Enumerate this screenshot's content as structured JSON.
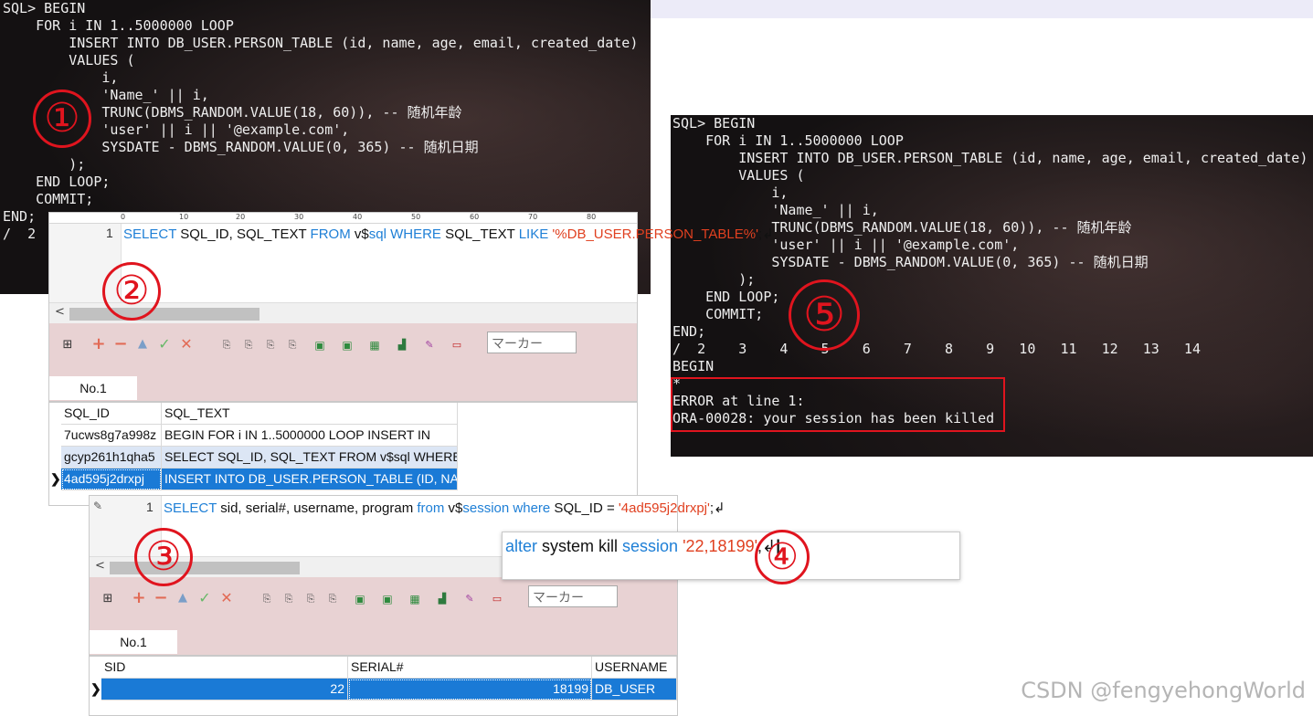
{
  "terminal1": {
    "lines": [
      "SQL> BEGIN",
      "    FOR i IN 1..5000000 LOOP",
      "        INSERT INTO DB_USER.PERSON_TABLE (id, name, age, email, created_date)",
      "        VALUES (",
      "            i,",
      "            'Name_' || i,",
      "            TRUNC(DBMS_RANDOM.VALUE(18, 60)), -- 随机年龄",
      "            'user' || i || '@example.com',",
      "            SYSDATE - DBMS_RANDOM.VALUE(0, 365) -- 随机日期",
      "        );",
      "    END LOOP;",
      "    COMMIT;",
      "END;",
      "/  2"
    ]
  },
  "terminal5": {
    "lines": [
      "SQL> BEGIN",
      "    FOR i IN 1..5000000 LOOP",
      "        INSERT INTO DB_USER.PERSON_TABLE (id, name, age, email, created_date)",
      "        VALUES (",
      "            i,",
      "            'Name_' || i,",
      "            TRUNC(DBMS_RANDOM.VALUE(18, 60)), -- 随机年龄",
      "            'user' || i || '@example.com',",
      "            SYSDATE - DBMS_RANDOM.VALUE(0, 365) -- 随机日期",
      "        );",
      "    END LOOP;",
      "    COMMIT;",
      "END;",
      "/  2    3    4    5    6    7    8    9   10   11   12   13   14",
      "BEGIN",
      "*",
      "ERROR at line 1:",
      "ORA-00028: your session has been killed"
    ]
  },
  "steps": [
    "①",
    "②",
    "③",
    "④",
    "⑤"
  ],
  "editor2": {
    "ruler": [
      "0",
      "10",
      "20",
      "30",
      "40",
      "50",
      "60",
      "70",
      "80"
    ],
    "line_number": "1",
    "sql": {
      "kw1": "SELECT",
      "t1": " SQL_ID, SQL_TEXT ",
      "kw2": "FROM",
      "t2": " v$",
      "kw3": "sql",
      "t3": " ",
      "kw4": "WHERE",
      "t4": " SQL_TEXT ",
      "kw5": "LIKE",
      "t5": " ",
      "str": "'%DB_USER.PERSON_TABLE%'",
      "end": ";↲"
    },
    "marker_placeholder": "マーカー",
    "tab": "No.1",
    "columns": [
      "SQL_ID",
      "SQL_TEXT"
    ],
    "rows": [
      [
        "7ucws8g7a998z",
        "BEGIN     FOR i IN 1..5000000 LOOP          INSERT IN"
      ],
      [
        "gcyp261h1qha5",
        "SELECT SQL_ID, SQL_TEXT FROM v$sql WHERE SQL"
      ],
      [
        "4ad595j2drxpj",
        "INSERT INTO DB_USER.PERSON_TABLE (ID, NAME,"
      ]
    ]
  },
  "editor3": {
    "line_number": "1",
    "sql": {
      "kw1": "SELECT",
      "t1": " sid, serial#, username, program ",
      "kw2": "from",
      "t2": " v$",
      "kw3": "session",
      "t3": " ",
      "kw4": "where",
      "t4": " SQL_ID = ",
      "str": "'4ad595j2drxpj'",
      "end": ";↲"
    },
    "marker_placeholder": "マーカー",
    "tab": "No.1",
    "columns": [
      "SID",
      "SERIAL#",
      "USERNAME"
    ],
    "rows": [
      [
        "22",
        "18199",
        "DB_USER"
      ]
    ]
  },
  "editor4": {
    "sql": {
      "kw1": "alter",
      "t1": " system kill ",
      "kw2": "session",
      "t2": " ",
      "str": "'22,18199'",
      "end": ";↲"
    }
  },
  "toolbar_icons": [
    "pin-icon",
    "add-icon",
    "remove-icon",
    "up-icon",
    "confirm-icon",
    "cancel-icon",
    "export-icon",
    "export-icon",
    "export-icon",
    "export-icon",
    "excel-icon",
    "excel-icon",
    "grid-icon",
    "chart-icon",
    "edit-icon",
    "record-icon"
  ],
  "colors": {
    "keyword": "#1e7fd6",
    "string": "#e04020",
    "selection": "#1a7ad6",
    "annotation": "#e0141e",
    "toolbar_bg": "#e8d2d3"
  },
  "watermark": "CSDN @fengyehongWorld"
}
